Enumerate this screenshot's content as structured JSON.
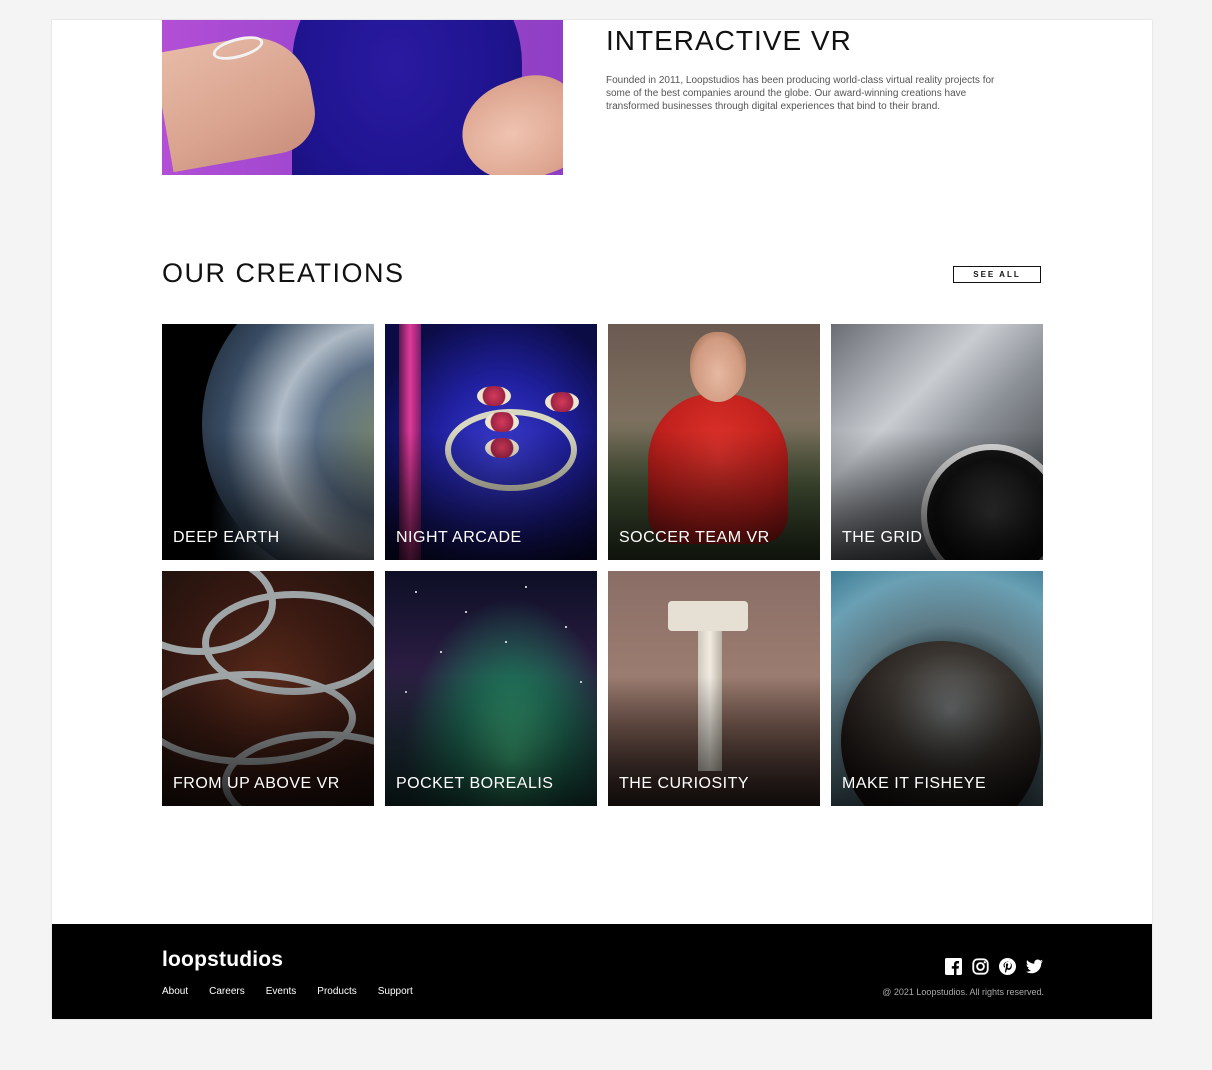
{
  "intro": {
    "title": "THE LEADER IN INTERACTIVE VR",
    "text": "Founded in 2011, Loopstudios has been producing world-class virtual reality projects for some of the best companies around the globe. Our award-winning creations have transformed businesses through digital experiences that bind to their brand."
  },
  "creations": {
    "title": "OUR CREATIONS",
    "see_all_label": "SEE ALL",
    "items": [
      {
        "label": "DEEP EARTH"
      },
      {
        "label": "NIGHT ARCADE"
      },
      {
        "label": "SOCCER TEAM VR"
      },
      {
        "label": "THE GRID"
      },
      {
        "label": "FROM UP ABOVE VR"
      },
      {
        "label": "POCKET BOREALIS"
      },
      {
        "label": "THE CURIOSITY"
      },
      {
        "label": "MAKE IT FISHEYE"
      }
    ]
  },
  "footer": {
    "logo": "loopstudios",
    "nav": [
      "About",
      "Careers",
      "Events",
      "Products",
      "Support"
    ],
    "socials": [
      "facebook-icon",
      "instagram-icon",
      "pinterest-icon",
      "twitter-icon"
    ],
    "copyright": "@ 2021 Loopstudios. All rights reserved."
  },
  "colors": {
    "page_background": "#f4f4f4",
    "footer_background": "#000000",
    "text": "#111111"
  }
}
